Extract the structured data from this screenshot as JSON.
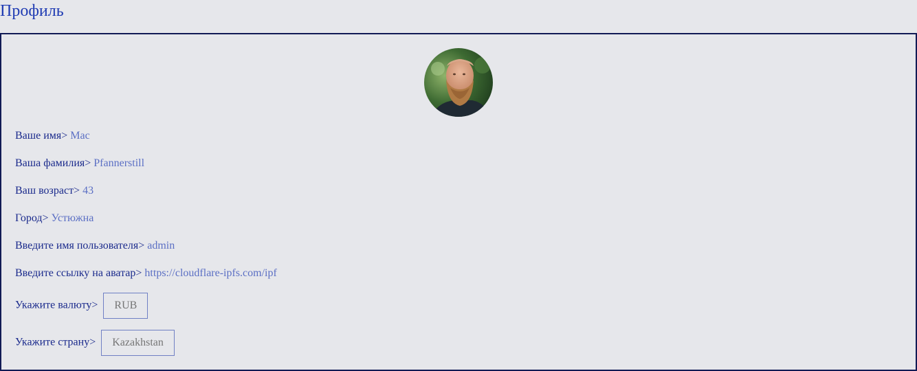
{
  "page": {
    "title": "Профиль"
  },
  "avatar": {
    "alt": "avatar"
  },
  "fields": {
    "name": {
      "label": "Ваше имя>",
      "value": "Mac"
    },
    "surname": {
      "label": "Ваша фамилия>",
      "value": "Pfannerstill"
    },
    "age": {
      "label": "Ваш возраст>",
      "value": "43"
    },
    "city": {
      "label": "Город>",
      "value": "Устюжна"
    },
    "username": {
      "label": "Введите имя пользователя>",
      "value": "admin"
    },
    "avatar_link": {
      "label": "Введите ссылку на аватар>",
      "value": "https://cloudflare-ipfs.com/ipf"
    },
    "currency": {
      "label": "Укажите валюту>",
      "placeholder": "RUB"
    },
    "country": {
      "label": "Укажите страну>",
      "placeholder": "Kazakhstan"
    }
  },
  "colors": {
    "background": "#e6e7eb",
    "title": "#1f3bb3",
    "border": "#111a55",
    "label": "#1a2a8c",
    "value": "#5b6fc4"
  }
}
